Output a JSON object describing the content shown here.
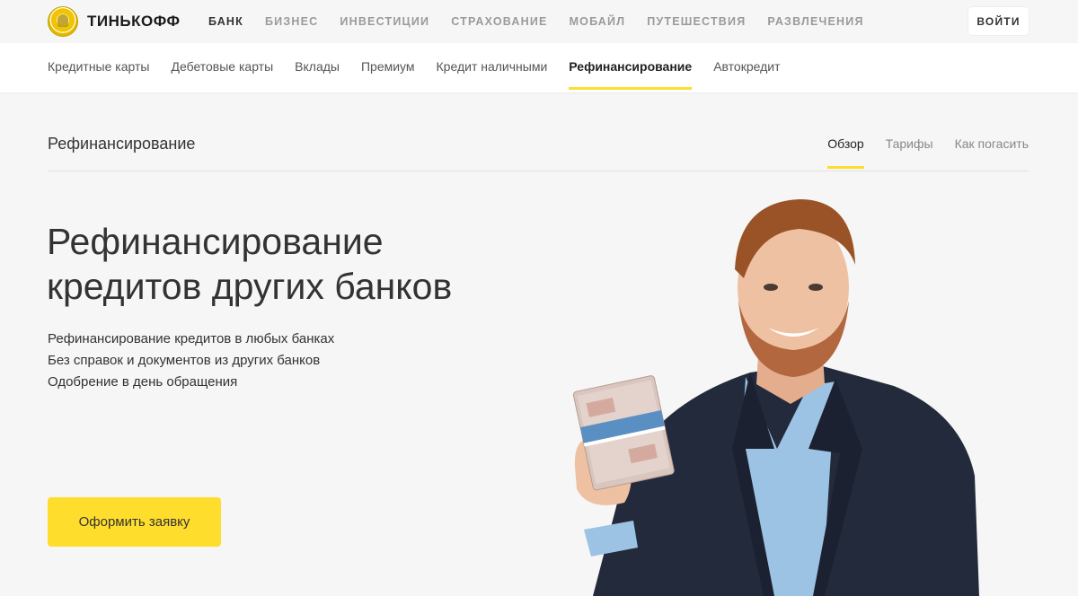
{
  "brand": {
    "name": "ТИНЬКОФФ"
  },
  "main_nav": [
    {
      "label": "БАНК",
      "active": true
    },
    {
      "label": "БИЗНЕС"
    },
    {
      "label": "ИНВЕСТИЦИИ"
    },
    {
      "label": "СТРАХОВАНИЕ"
    },
    {
      "label": "МОБАЙЛ"
    },
    {
      "label": "ПУТЕШЕСТВИЯ"
    },
    {
      "label": "РАЗВЛЕЧЕНИЯ"
    }
  ],
  "login": {
    "label": "ВОЙТИ"
  },
  "sub_nav": [
    {
      "label": "Кредитные карты"
    },
    {
      "label": "Дебетовые карты"
    },
    {
      "label": "Вклады"
    },
    {
      "label": "Премиум"
    },
    {
      "label": "Кредит наличными"
    },
    {
      "label": "Рефинансирование",
      "active": true
    },
    {
      "label": "Автокредит"
    }
  ],
  "section": {
    "title": "Рефинансирование",
    "tabs": [
      {
        "label": "Обзор",
        "active": true
      },
      {
        "label": "Тарифы"
      },
      {
        "label": "Как погасить"
      }
    ]
  },
  "hero": {
    "title_line1": "Рефинансирование",
    "title_line2": "кредитов других банков",
    "points": [
      "Рефинансирование кредитов в любых банках",
      "Без справок и документов из других банков",
      "Одобрение в день обращения"
    ],
    "cta_label": "Оформить заявку"
  },
  "colors": {
    "accent": "#ffdd2d",
    "background": "#f6f6f6"
  }
}
